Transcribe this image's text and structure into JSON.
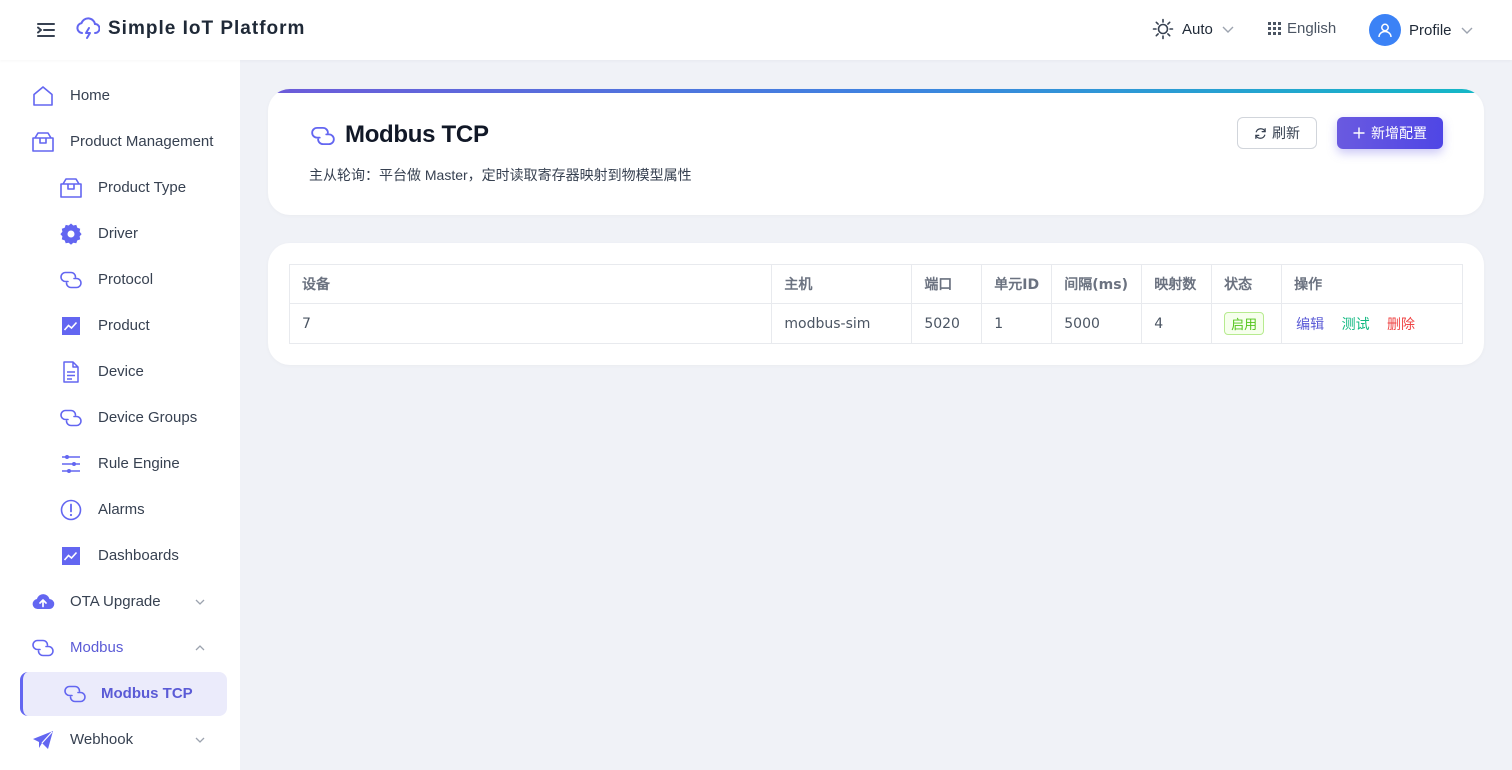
{
  "header": {
    "app_title": "Simple IoT Platform",
    "theme_label": "Auto",
    "language_label": "English",
    "profile_label": "Profile"
  },
  "sidebar": {
    "items": [
      {
        "label": "Home",
        "icon": "home-icon"
      },
      {
        "label": "Product Management",
        "icon": "box-icon"
      },
      {
        "label": "Product Type",
        "icon": "box-icon"
      },
      {
        "label": "Driver",
        "icon": "gear-icon"
      },
      {
        "label": "Protocol",
        "icon": "link-icon"
      },
      {
        "label": "Product",
        "icon": "chart-icon"
      },
      {
        "label": "Device",
        "icon": "document-icon"
      },
      {
        "label": "Device Groups",
        "icon": "link-icon"
      },
      {
        "label": "Rule Engine",
        "icon": "sliders-icon"
      },
      {
        "label": "Alarms",
        "icon": "alert-icon"
      },
      {
        "label": "Dashboards",
        "icon": "chart-icon"
      },
      {
        "label": "OTA Upgrade",
        "icon": "cloud-upload-icon"
      },
      {
        "label": "Modbus",
        "icon": "link-icon"
      },
      {
        "label": "Modbus TCP",
        "icon": "link-icon"
      },
      {
        "label": "Webhook",
        "icon": "send-icon"
      }
    ]
  },
  "page": {
    "title": "Modbus TCP",
    "subtitle": "主从轮询：平台做 Master，定时读取寄存器映射到物模型属性",
    "refresh_label": "刷新",
    "add_label": "新增配置"
  },
  "table": {
    "columns": [
      "设备",
      "主机",
      "端口",
      "单元ID",
      "间隔(ms)",
      "映射数",
      "状态",
      "操作"
    ],
    "rows": [
      {
        "device": "7",
        "host": "modbus-sim",
        "port": "5020",
        "unit_id": "1",
        "interval": "5000",
        "mappings": "4",
        "status": "启用",
        "actions": {
          "edit": "编辑",
          "test": "测试",
          "delete": "删除"
        }
      }
    ]
  },
  "colors": {
    "accent": "#5b5bd6",
    "status_enabled": "#52c41a",
    "action_test": "#10b981",
    "action_delete": "#ef4444"
  }
}
